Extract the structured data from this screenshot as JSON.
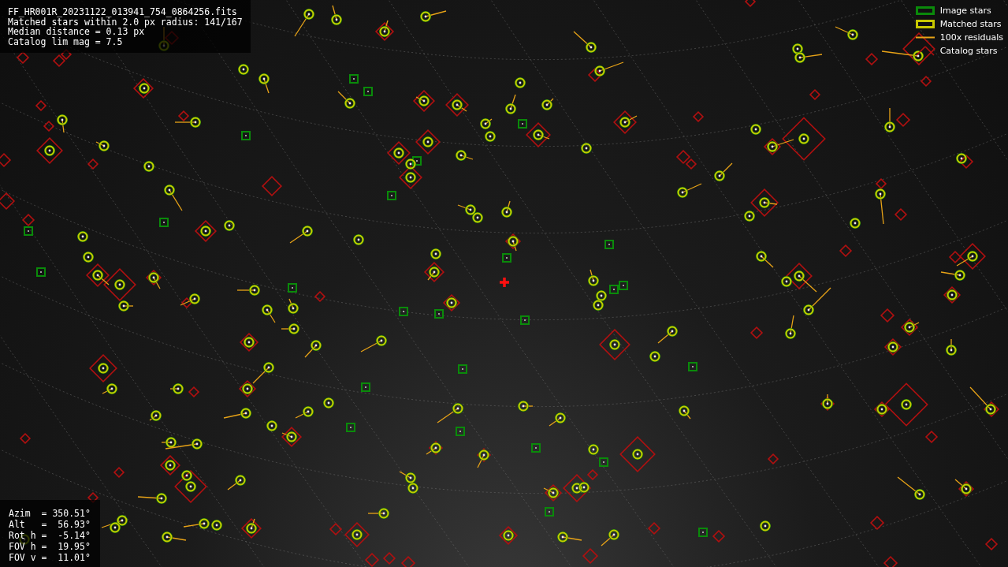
{
  "header": {
    "lines": [
      "FF_HR001R_20231122_013941_754_0864256.fits",
      "Matched stars within 2.0 px radius: 141/167",
      "Median distance = 0.13 px",
      "Catalog lim mag = 7.5"
    ]
  },
  "legend": [
    {
      "kind": "image",
      "label": "Image stars"
    },
    {
      "kind": "matched",
      "label": "Matched stars"
    },
    {
      "kind": "residual",
      "label": "100x residuals"
    },
    {
      "kind": "catalog",
      "label": "Catalog stars"
    }
  ],
  "pointing": {
    "lines": [
      "Azim  = 350.51°",
      "Alt   =  56.93°",
      "Rot h =  -5.14°",
      "FOV h =  19.95°",
      "FOV v =  11.01°"
    ]
  }
}
